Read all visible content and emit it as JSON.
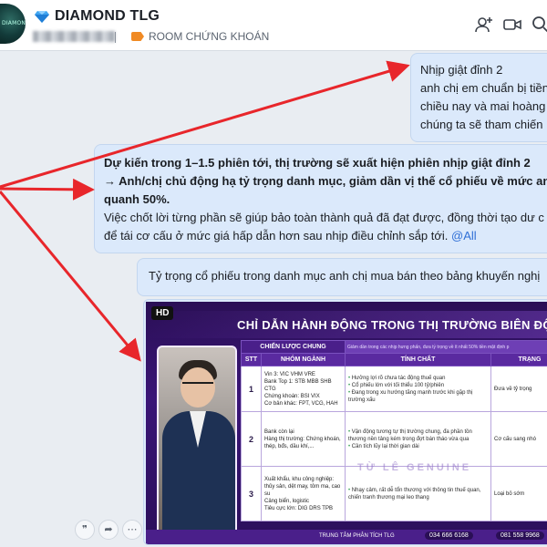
{
  "header": {
    "group_name": "DIAMOND TLG",
    "room_label": "ROOM CHỨNG KHOÁN",
    "icons": [
      "add-member-icon",
      "video-call-icon",
      "search-icon"
    ]
  },
  "messages": {
    "m1": {
      "lines": [
        "Nhịp giật đỉnh 2",
        "anh chị em chuẩn bị tiền",
        "chiều nay và mai hoàng",
        "chúng ta sẽ tham chiến"
      ]
    },
    "m2": {
      "bold_line1": "Dự kiến trong 1–1.5 phiên tới, thị trường sẽ xuất hiện phiên nhịp giật đỉnh 2",
      "bold_line2": "→ Anh/chị chủ động hạ tỷ trọng danh mục, giảm dần vị thế cổ phiếu về mức an to",
      "bold_line3": "quanh 50%.",
      "line4": "Việc chốt lời từng phần sẽ giúp bảo toàn thành quả đã đạt được, đồng thời tạo dư c",
      "line5": "để tái cơ cấu ở mức giá hấp dẫn hơn sau nhịp điều chỉnh sắp tới.",
      "mention": "@All"
    },
    "m3": {
      "text": "Tỷ trọng cổ phiếu trong danh mục anh chị mua bán theo bảng khuyến nghị"
    }
  },
  "image": {
    "badge": "HD",
    "title": "CHỈ DẪN HÀNH ĐỘNG TRONG THỊ TRƯỜNG BIÊN ĐỘ LỚ",
    "strategy_header": "CHIẾN LƯỢC CHUNG",
    "strategy_note": "Giảm dần trong các nhịp hưng phấn, đưa tỷ trọng về ít nhất 50% tiền mặt định p",
    "columns": [
      "STT",
      "NHÓM NGÀNH",
      "TÍNH CHẤT",
      "TRẠNG"
    ],
    "rows": [
      {
        "stt": "1",
        "group_lines": [
          "Vin 3: VIC VHM VRE",
          "Bank Top 1: STB MBB SHB CTG",
          "Chứng khoán: BSI VIX",
          "Cơ bản khác: FPT, VCG, HAH"
        ],
        "props": [
          "Hưởng lợi rõ chưa tác động thuế quan",
          "Cổ phiếu lớn với tối thiểu 100 tỷ/phiên",
          "Đang trong xu hướng tăng mạnh trước khi gặp thị trường xấu"
        ],
        "state": "Đưa về tỷ trọng"
      },
      {
        "stt": "2",
        "group_lines": [
          "Bank còn lại",
          "Hàng thị trường: Chứng khoán,",
          "thép, bđs, dầu khí,..."
        ],
        "props": [
          "Vận động tương tự thị trường chung, đa phần tồn thương nền tảng kém trong đợt bán tháo vừa qua",
          "Cần tích lũy lại thời gian dài"
        ],
        "state": "Cơ cấu sang nhó"
      },
      {
        "stt": "3",
        "group_lines": [
          "Xuất khẩu, khu công nghiệp:",
          "thủy sản, dệt may, tôm ma, cao su",
          "Cảng biển, logistic",
          "Tiêu cực lớn: DIG DRS TPB"
        ],
        "props": [
          "Nhạy cảm, rất dễ tổn thương với thông tin thuế quan, chiến tranh thương mại leo thang"
        ],
        "state": "Loại bỏ sớm"
      }
    ],
    "watermark": "TỪ LÊ GENUINE",
    "footer_center": "TRUNG TÂM PHÂN TÍCH TLG",
    "footer_phone1": "034 666 6168",
    "footer_phone2": "081 558 9968"
  },
  "reactions": [
    "❞",
    "➦",
    "⋯"
  ],
  "colors": {
    "bubble": "#dbe9fb",
    "arrow": "#e8262b",
    "mention": "#2f6fd6",
    "poster": "#3a1577"
  }
}
